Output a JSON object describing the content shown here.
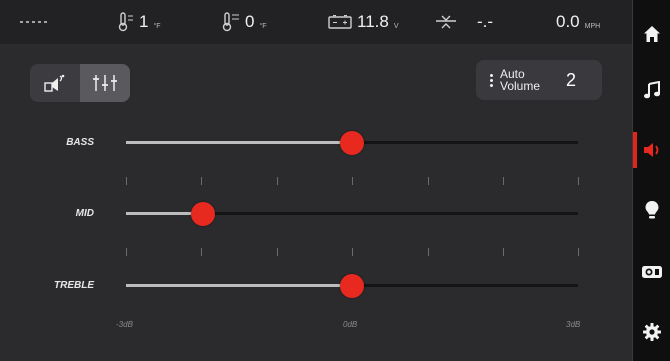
{
  "status": {
    "temp1": {
      "value": "1",
      "unit": "°F"
    },
    "temp2": {
      "value": "0",
      "unit": "°F"
    },
    "battery": {
      "value": "11.8",
      "unit": "V"
    },
    "fuel": {
      "value": "-.-"
    },
    "speed": {
      "value": "0.0",
      "unit": "MPH"
    }
  },
  "auto_volume": {
    "label_line1": "Auto",
    "label_line2": "Volume",
    "value": "2"
  },
  "tone": {
    "bass": {
      "label": "BASS",
      "level": 0.5
    },
    "mid": {
      "label": "MID",
      "level": 0.17
    },
    "treble": {
      "label": "TREBLE",
      "level": 0.5
    }
  },
  "scale": {
    "min": "-3dB",
    "mid": "0dB",
    "max": "3dB"
  },
  "sidebar": [
    "home-icon",
    "music-icon",
    "volume-icon",
    "light-icon",
    "camera-icon",
    "settings-icon"
  ],
  "colors": {
    "accent": "#e8291f",
    "background": "#2b2b2e",
    "sidebar": "#0f0f10"
  }
}
